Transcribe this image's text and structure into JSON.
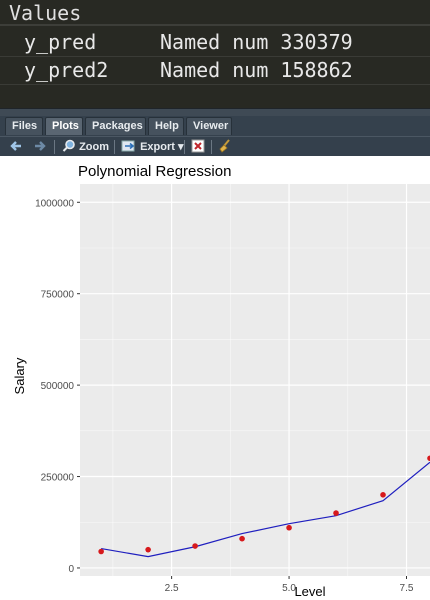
{
  "environment": {
    "title": "Values",
    "rows": [
      {
        "name": "y_pred",
        "value": "Named num 330379"
      },
      {
        "name": "y_pred2",
        "value": "Named num 158862"
      }
    ]
  },
  "tabs": [
    "Files",
    "Plots",
    "Packages",
    "Help",
    "Viewer"
  ],
  "active_tab": "Plots",
  "toolbar": {
    "zoom_label": "Zoom",
    "export_label": "Export",
    "export_caret": "▾"
  },
  "colors": {
    "points": "#d7191c",
    "line": "#1f1fbf",
    "panel_bg": "#ebebeb",
    "grid": "#ffffff"
  },
  "chart_data": {
    "type": "scatter",
    "title": "Polynomial Regression",
    "xlabel": "Level",
    "ylabel": "Salary",
    "xlim": [
      0.55,
      8.0
    ],
    "ylim": [
      -22000,
      1050000
    ],
    "x_ticks": [
      2.5,
      5.0,
      7.5
    ],
    "x_tick_labels": [
      "2.5",
      "5.0",
      "7.5"
    ],
    "y_ticks": [
      0,
      250000,
      500000,
      750000,
      1000000
    ],
    "y_tick_labels": [
      "0",
      "250000",
      "500000",
      "750000",
      "1000000"
    ],
    "grid": true,
    "series": [
      {
        "kind": "points",
        "x": [
          1,
          2,
          3,
          4,
          5,
          6,
          7,
          8
        ],
        "y": [
          45000,
          50000,
          60000,
          80000,
          110000,
          150000,
          200000,
          300000
        ]
      },
      {
        "kind": "line",
        "x": [
          1,
          2,
          3,
          4,
          5,
          6,
          7,
          8
        ],
        "y": [
          53000,
          31000,
          58000,
          94000,
          121000,
          143000,
          184000,
          289000
        ]
      }
    ]
  }
}
